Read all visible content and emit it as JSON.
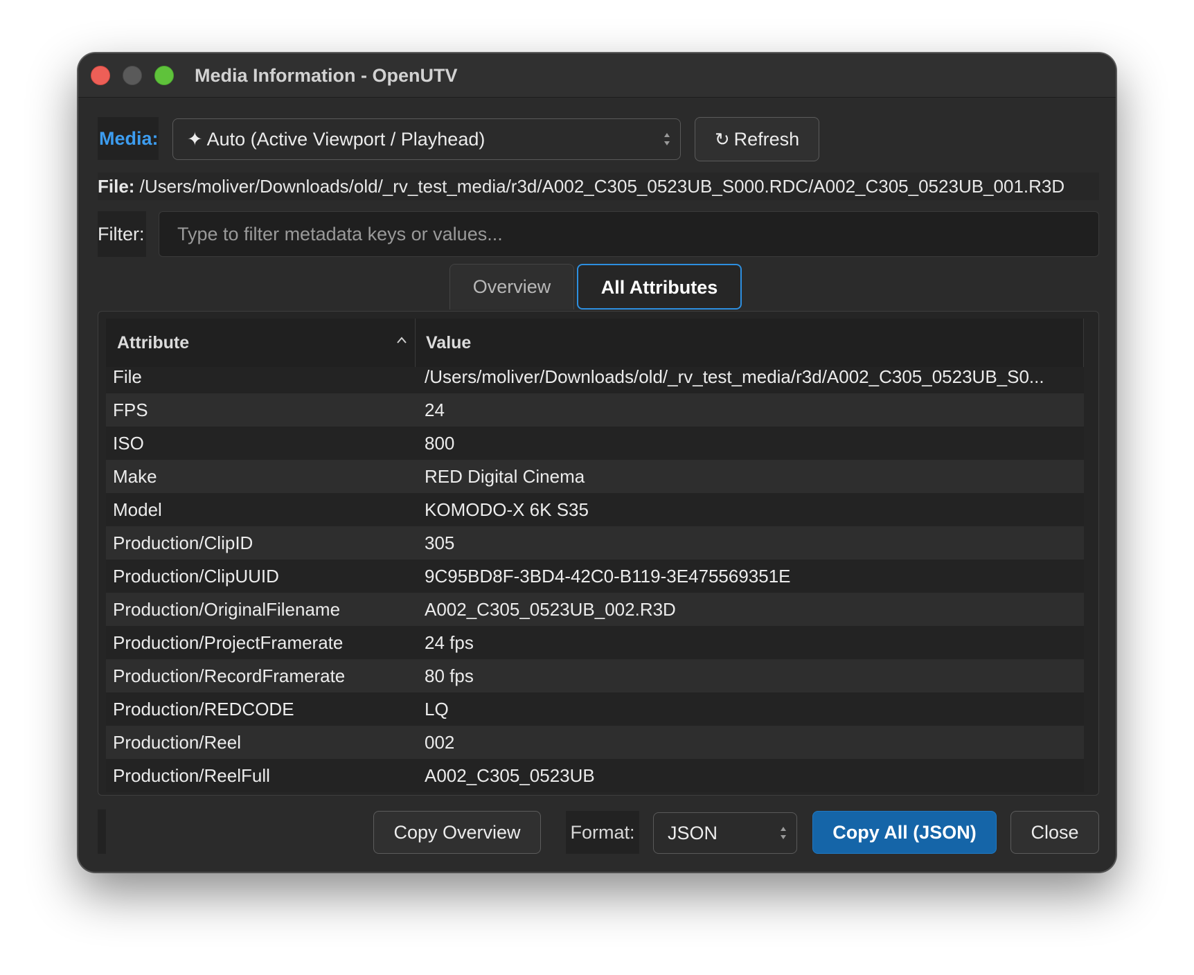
{
  "window": {
    "title": "Media Information - OpenUTV"
  },
  "media": {
    "label": "Media:",
    "selected": "✦ Auto (Active Viewport / Playhead)",
    "refresh_label": "Refresh"
  },
  "file": {
    "label": "File:",
    "path": " /Users/moliver/Downloads/old/_rv_test_media/r3d/A002_C305_0523UB_S000.RDC/A002_C305_0523UB_001.R3D"
  },
  "filter": {
    "label": "Filter:",
    "placeholder": "Type to filter metadata keys or values...",
    "value": ""
  },
  "tabs": [
    {
      "label": "Overview",
      "active": false
    },
    {
      "label": "All Attributes",
      "active": true
    }
  ],
  "table": {
    "headers": {
      "attribute": "Attribute",
      "value": "Value"
    },
    "sort": "ascending",
    "rows": [
      {
        "attribute": "File",
        "value": "/Users/moliver/Downloads/old/_rv_test_media/r3d/A002_C305_0523UB_S0..."
      },
      {
        "attribute": "FPS",
        "value": "24"
      },
      {
        "attribute": "ISO",
        "value": "800"
      },
      {
        "attribute": "Make",
        "value": "RED Digital Cinema"
      },
      {
        "attribute": "Model",
        "value": "KOMODO-X 6K S35"
      },
      {
        "attribute": "Production/ClipID",
        "value": "305"
      },
      {
        "attribute": "Production/ClipUUID",
        "value": "9C95BD8F-3BD4-42C0-B119-3E475569351E"
      },
      {
        "attribute": "Production/OriginalFilename",
        "value": "A002_C305_0523UB_002.R3D"
      },
      {
        "attribute": "Production/ProjectFramerate",
        "value": "24 fps"
      },
      {
        "attribute": "Production/RecordFramerate",
        "value": "80 fps"
      },
      {
        "attribute": "Production/REDCODE",
        "value": "LQ"
      },
      {
        "attribute": "Production/Reel",
        "value": "002"
      },
      {
        "attribute": "Production/ReelFull",
        "value": "A002_C305_0523UB"
      }
    ]
  },
  "footer": {
    "copy_overview_label": "Copy Overview",
    "format_label": "Format:",
    "format_selected": "JSON",
    "copy_all_label": "Copy All (JSON)",
    "close_label": "Close"
  },
  "colors": {
    "accent": "#3d9df0",
    "primary_button": "#1565a8",
    "tab_focus": "#2d8fe0"
  }
}
